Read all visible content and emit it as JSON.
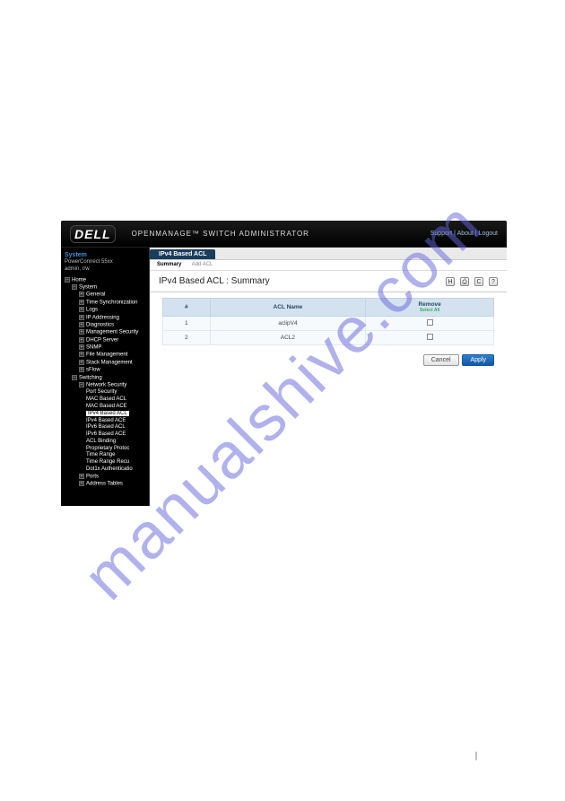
{
  "watermark": "manualshive.com",
  "header": {
    "logo": "DELL",
    "title": "OPENMANAGE™ SWITCH ADMINISTRATOR",
    "links": {
      "support": "Support",
      "about": "About",
      "logout": "Logout"
    }
  },
  "sidebar": {
    "system_label": "System",
    "system_sub1": "PowerConnect 55xx",
    "system_sub2": "admin, r/w",
    "tree": {
      "home": "Home",
      "system": "System",
      "general": "General",
      "time_sync": "Time Synchronization",
      "logs": "Logs",
      "ip_addressing": "IP Addressing",
      "diagnostics": "Diagnostics",
      "mgmt_security": "Management Security",
      "dhcp_server": "DHCP Server",
      "snmp": "SNMP",
      "file_mgmt": "File Management",
      "stack_mgmt": "Stack Management",
      "sflow": "sFlow",
      "switching": "Switching",
      "network_security": "Network Security",
      "port_security": "Port Security",
      "mac_based_acl": "MAC Based ACL",
      "mac_based_ace": "MAC Based ACE",
      "ipv4_based_acl": "IPv4 Based ACL",
      "ipv4_based_ace": "IPv4 Based ACE",
      "ipv6_based_acl": "IPv6 Based ACL",
      "ipv6_based_ace": "IPv6 Based ACE",
      "acl_binding": "ACL Binding",
      "proprietary_protoc": "Proprietary Protoc",
      "time_range": "Time Range",
      "time_range_recu": "Time Range Recu",
      "dot1x_auth": "Dot1x Authenticatio",
      "ports": "Ports",
      "address_tables": "Address Tables"
    }
  },
  "main": {
    "tab_label": "IPv4 Based ACL",
    "subtab_summary": "Summary",
    "subtab_add": "Add ACL",
    "page_title": "IPv4 Based ACL : Summary",
    "columns": {
      "num": "#",
      "name": "ACL Name",
      "remove": "Remove"
    },
    "select_all": "Select All",
    "rows": [
      {
        "num": "1",
        "name": "aclipV4"
      },
      {
        "num": "2",
        "name": "ACL2"
      }
    ],
    "buttons": {
      "cancel": "Cancel",
      "apply": "Apply"
    },
    "toolbar_icons": {
      "save": "H",
      "print": "⎙",
      "refresh": "C",
      "help": "?"
    }
  },
  "footer_mark": "|"
}
